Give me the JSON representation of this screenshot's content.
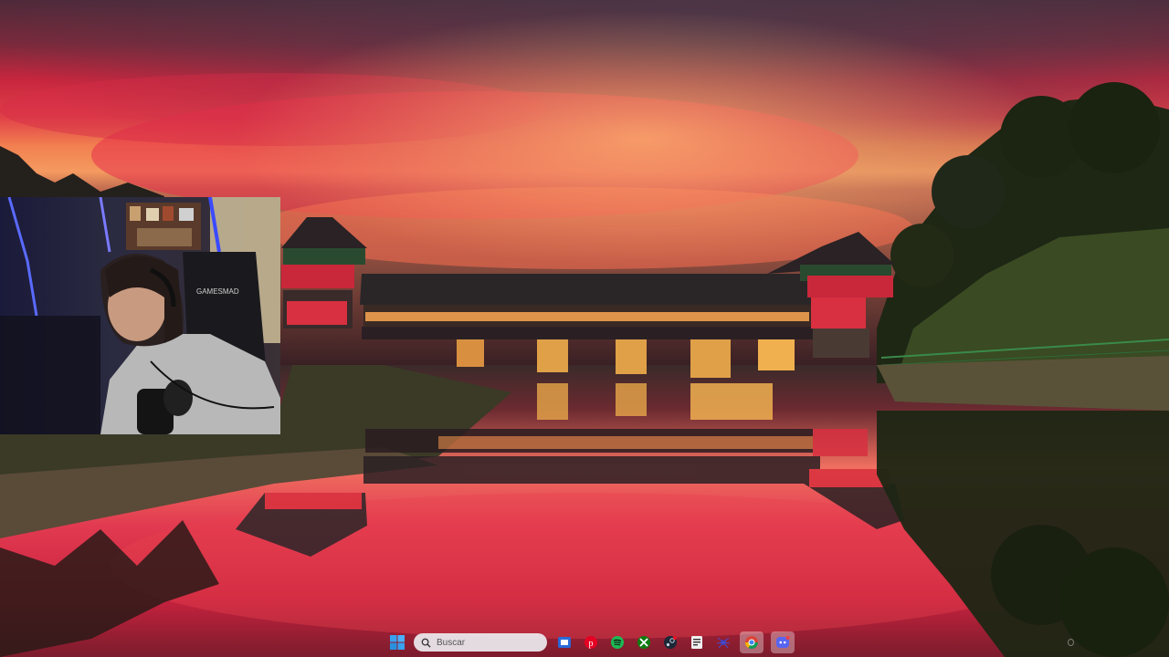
{
  "taskbar": {
    "search_placeholder": "Buscar",
    "pinned_apps": [
      {
        "name": "file-explorer-icon"
      },
      {
        "name": "pinterest-icon"
      },
      {
        "name": "spotify-icon"
      },
      {
        "name": "xbox-icon"
      },
      {
        "name": "steam-icon"
      },
      {
        "name": "notes-icon"
      },
      {
        "name": "spider-icon"
      },
      {
        "name": "chrome-icon"
      },
      {
        "name": "discord-icon"
      }
    ]
  },
  "colors": {
    "sky_top": "#5a2434",
    "sky_mid": "#c8263e",
    "sky_glow": "#f07a4a",
    "water": "#d8304a",
    "foliage": "#1e2a14",
    "taskbar_search": "#ebebf0"
  }
}
